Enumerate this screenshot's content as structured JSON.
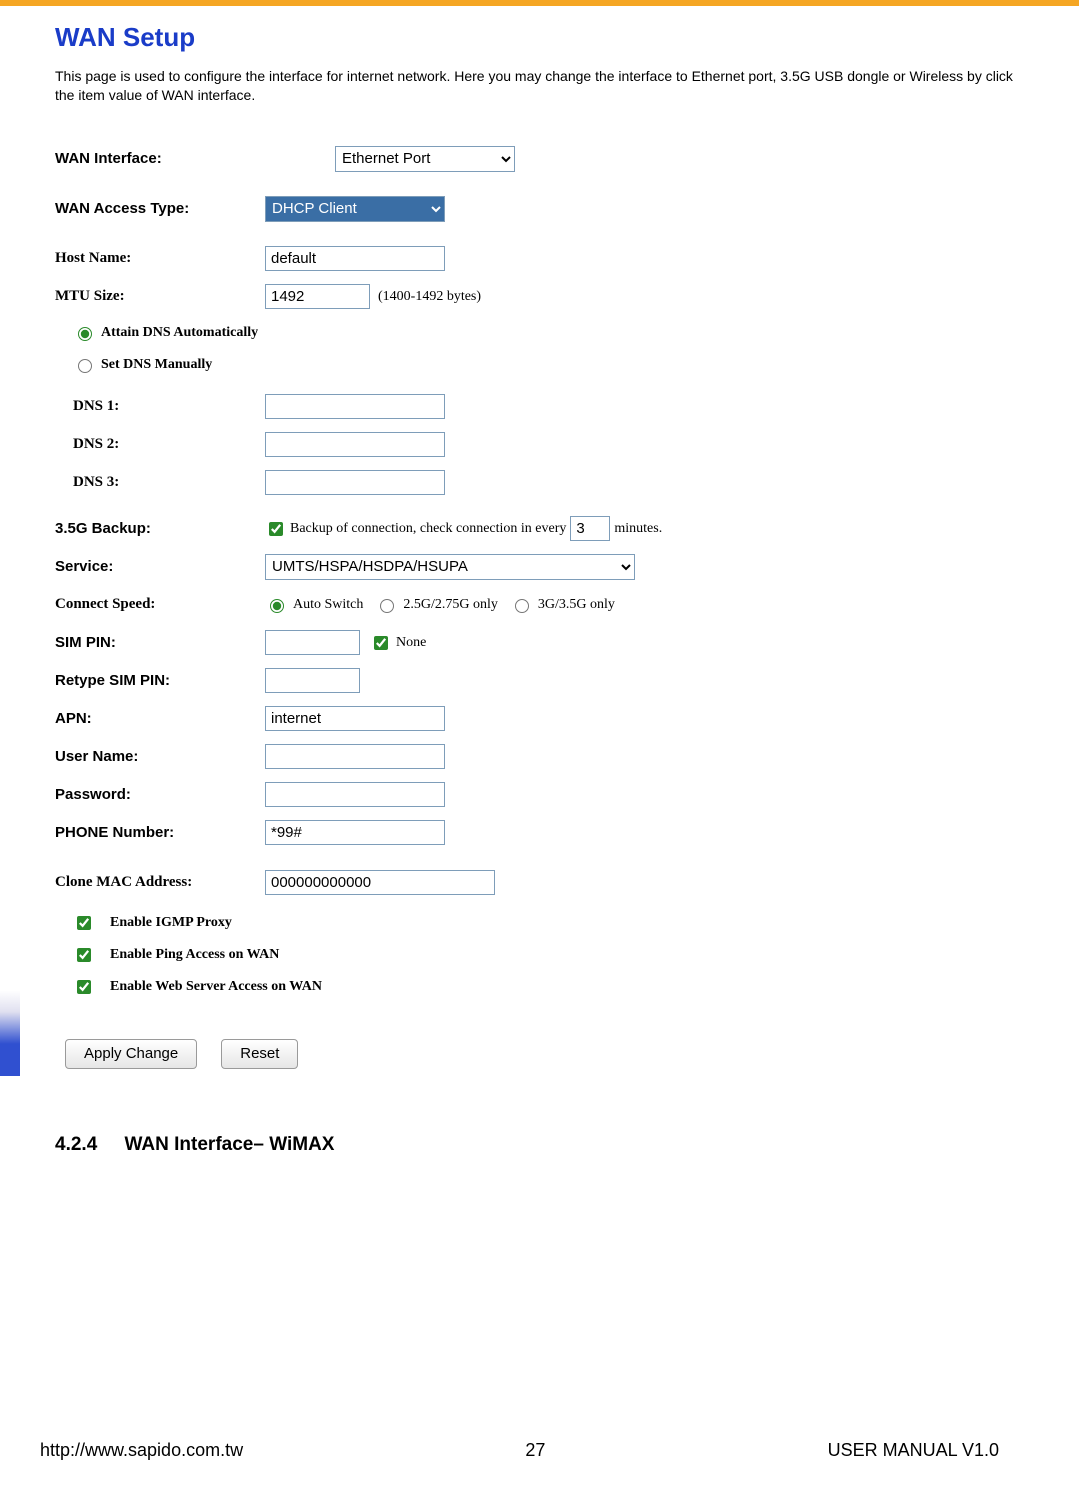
{
  "header": {
    "title": "WAN Setup",
    "description": "This page is used to configure the interface for internet network. Here you may change the interface to Ethernet port, 3.5G USB dongle or Wireless by click the item value of WAN interface."
  },
  "form": {
    "wan_interface": {
      "label": "WAN Interface:",
      "value": "Ethernet Port"
    },
    "wan_access_type": {
      "label": "WAN Access Type:",
      "value": "DHCP Client"
    },
    "host_name": {
      "label": "Host Name:",
      "value": "default"
    },
    "mtu": {
      "label": "MTU Size:",
      "value": "1492",
      "hint": "(1400-1492 bytes)"
    },
    "dns_mode": {
      "auto_label": "Attain DNS Automatically",
      "manual_label": "Set DNS Manually",
      "dns1_label": "DNS 1:",
      "dns2_label": "DNS 2:",
      "dns3_label": "DNS 3:",
      "dns1": "",
      "dns2": "",
      "dns3": ""
    },
    "backup": {
      "label": "3.5G Backup:",
      "text_pre": "Backup of connection, check connection in every",
      "value": "3",
      "text_post": "minutes."
    },
    "service": {
      "label": "Service:",
      "value": "UMTS/HSPA/HSDPA/HSUPA"
    },
    "connect_speed": {
      "label": "Connect Speed:",
      "opt1": "Auto Switch",
      "opt2": "2.5G/2.75G only",
      "opt3": "3G/3.5G only"
    },
    "sim_pin": {
      "label": "SIM PIN:",
      "value": "",
      "none_label": "None"
    },
    "retype_sim_pin": {
      "label": "Retype SIM PIN:",
      "value": ""
    },
    "apn": {
      "label": "APN:",
      "value": "internet"
    },
    "user_name": {
      "label": "User Name:",
      "value": ""
    },
    "password": {
      "label": "Password:",
      "value": ""
    },
    "phone": {
      "label": "PHONE Number:",
      "value": "*99#"
    },
    "clone_mac": {
      "label": "Clone MAC Address:",
      "value": "000000000000"
    },
    "chk_igmp": "Enable IGMP Proxy",
    "chk_ping": "Enable Ping Access on WAN",
    "chk_web": "Enable Web Server Access on WAN"
  },
  "buttons": {
    "apply": "Apply Change",
    "reset": "Reset"
  },
  "section": {
    "num": "4.2.4",
    "title": "WAN Interface– WiMAX"
  },
  "footer": {
    "url": "http://www.sapido.com.tw",
    "page": "27",
    "manual": "USER MANUAL V1.0"
  }
}
